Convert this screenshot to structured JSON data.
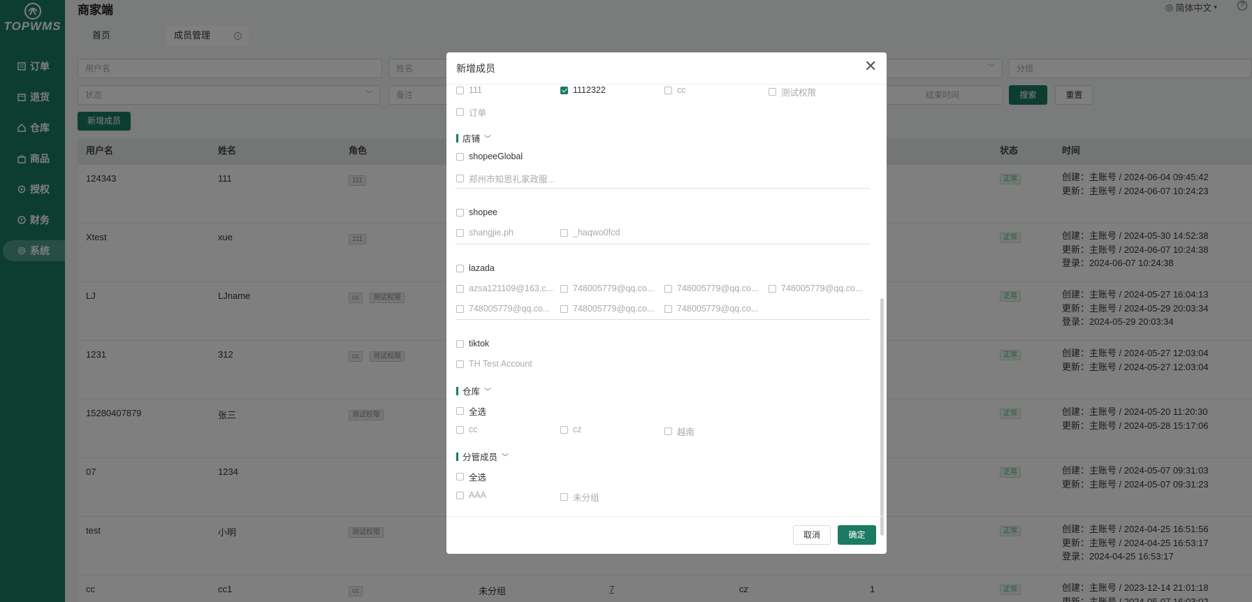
{
  "sidebar": {
    "logo_text": "TOPWMS",
    "items": [
      {
        "label": "订单",
        "icon": "list-icon"
      },
      {
        "label": "退货",
        "icon": "return-icon"
      },
      {
        "label": "仓库",
        "icon": "home-icon"
      },
      {
        "label": "商品",
        "icon": "bag-icon"
      },
      {
        "label": "授权",
        "icon": "key-icon"
      },
      {
        "label": "财务",
        "icon": "finance-icon"
      },
      {
        "label": "系统",
        "icon": "gear-icon"
      }
    ]
  },
  "header": {
    "title": "商家端",
    "lang": "简体中文",
    "help": "?"
  },
  "tabs": [
    {
      "label": "首页"
    },
    {
      "label": "成员管理"
    }
  ],
  "filters": {
    "username": "用户名",
    "name": "姓名",
    "group": "分组",
    "status": "状态",
    "remark": "备注",
    "end_time": "结束时间",
    "search": "搜索",
    "reset": "重置",
    "add": "新增成员"
  },
  "table": {
    "headers": [
      "用户名",
      "姓名",
      "角色",
      "状态",
      "时间"
    ],
    "rows": [
      {
        "username": "124343",
        "name": "111",
        "roles": [
          "111"
        ],
        "status": "正常",
        "times": [
          "创建：主账号 / 2024-06-04 09:45:42",
          "更新：主账号 / 2024-06-07 10:24:23"
        ]
      },
      {
        "username": "Xtest",
        "name": "xue",
        "roles": [
          "111"
        ],
        "status": "正常",
        "times": [
          "创建：主账号 / 2024-05-30 14:52:38",
          "更新：主账号 / 2024-06-07 10:24:38",
          "登录：2024-06-07 10:24:38"
        ]
      },
      {
        "username": "LJ",
        "name": "LJname",
        "roles": [
          "cc",
          "测试权限"
        ],
        "status": "正常",
        "times": [
          "创建：主账号 / 2024-05-27 16:04:13",
          "更新：主账号 / 2024-05-29 20:03:34",
          "登录：2024-05-29 20:03:34"
        ]
      },
      {
        "username": "1231",
        "name": "312",
        "roles": [
          "cc",
          "测试权限"
        ],
        "status": "正常",
        "times": [
          "创建：主账号 / 2024-05-27 12:03:04",
          "更新：主账号 / 2024-05-27 12:03:04"
        ]
      },
      {
        "username": "15280407879",
        "name": "张三",
        "roles": [
          "测试权限"
        ],
        "status": "正常",
        "times": [
          "创建：主账号 / 2024-05-20 11:20:30",
          "更新：主账号 / 2024-05-28 15:17:06"
        ]
      },
      {
        "username": "07",
        "name": "1234",
        "roles": [],
        "status": "正常",
        "times": [
          "创建：主账号 / 2024-05-07 09:31:03",
          "更新：主账号 / 2024-05-07 09:31:23"
        ]
      },
      {
        "username": "test",
        "name": "小明",
        "roles": [
          "测试权限"
        ],
        "status": "正常",
        "times": [
          "创建：主账号 / 2024-04-25 16:51:56",
          "更新：主账号 / 2024-04-25 16:53:17",
          "登录：2024-04-25 16:53:17"
        ]
      },
      {
        "username": "cc",
        "name": "cc1",
        "roles": [
          "cc"
        ],
        "group": "未分组",
        "link": "7",
        "warehouse": "cz",
        "count": "1",
        "status": "正常",
        "times": [
          "创建：主账号 / 2023-12-14 21:01:18",
          "更新：主账号 / 2024-05-07 16:03:02"
        ]
      }
    ]
  },
  "modal": {
    "title": "新增成员",
    "top_roles": [
      "111",
      "1112322",
      "cc",
      "测试权限"
    ],
    "top_role2": "订单",
    "shop_section": "店铺",
    "shop_groups": [
      {
        "platform": "shopeeGlobal",
        "accounts": [
          "郑州市知恩礼家政服..."
        ]
      },
      {
        "platform": "shopee",
        "accounts": [
          "shangjie.ph",
          "_haqwo0fcd"
        ]
      },
      {
        "platform": "lazada",
        "accounts": [
          "azsa121109@163.c...",
          "748005779@qq.co...",
          "748005779@qq.co...",
          "748005779@qq.co...",
          "748005779@qq.co...",
          "748005779@qq.co...",
          "748005779@qq.co..."
        ]
      },
      {
        "platform": "tiktok",
        "accounts": [
          "TH Test Account"
        ]
      }
    ],
    "warehouse_section": "仓库",
    "warehouse_all": "全选",
    "warehouses": [
      "cc",
      "cz",
      "越南"
    ],
    "sub_section": "分管成员",
    "sub_all": "全选",
    "subs": [
      "AAA",
      "未分组"
    ],
    "cancel": "取消",
    "confirm": "确定"
  }
}
